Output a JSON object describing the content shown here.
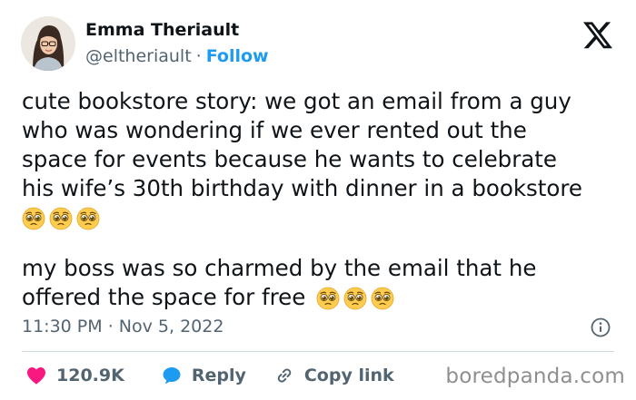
{
  "author": {
    "name": "Emma Theriault",
    "handle": "@eltheriault",
    "separator": "·",
    "follow_label": "Follow"
  },
  "logo": "x-logo-icon",
  "tweet": {
    "paragraph1": [
      "cute bookstore story: we got an email from a guy",
      "who was wondering if we ever rented out the",
      "space for events because he wants to celebrate",
      "his wife’s 30th birthday with dinner in a bookstore"
    ],
    "paragraph2": [
      "my boss was so charmed by the email that he",
      "offered the space for free"
    ],
    "emoji": "pleading-face-emoji"
  },
  "meta": {
    "time": "11:30 PM",
    "separator": "·",
    "date": "Nov 5, 2022"
  },
  "actions": {
    "likes": "120.9K",
    "reply_label": "Reply",
    "copy_link_label": "Copy link"
  },
  "watermark": "boredpanda.com",
  "colors": {
    "accent": "#1d9bf0",
    "like": "#f91880",
    "text": "#0f1419",
    "muted": "#536471"
  }
}
